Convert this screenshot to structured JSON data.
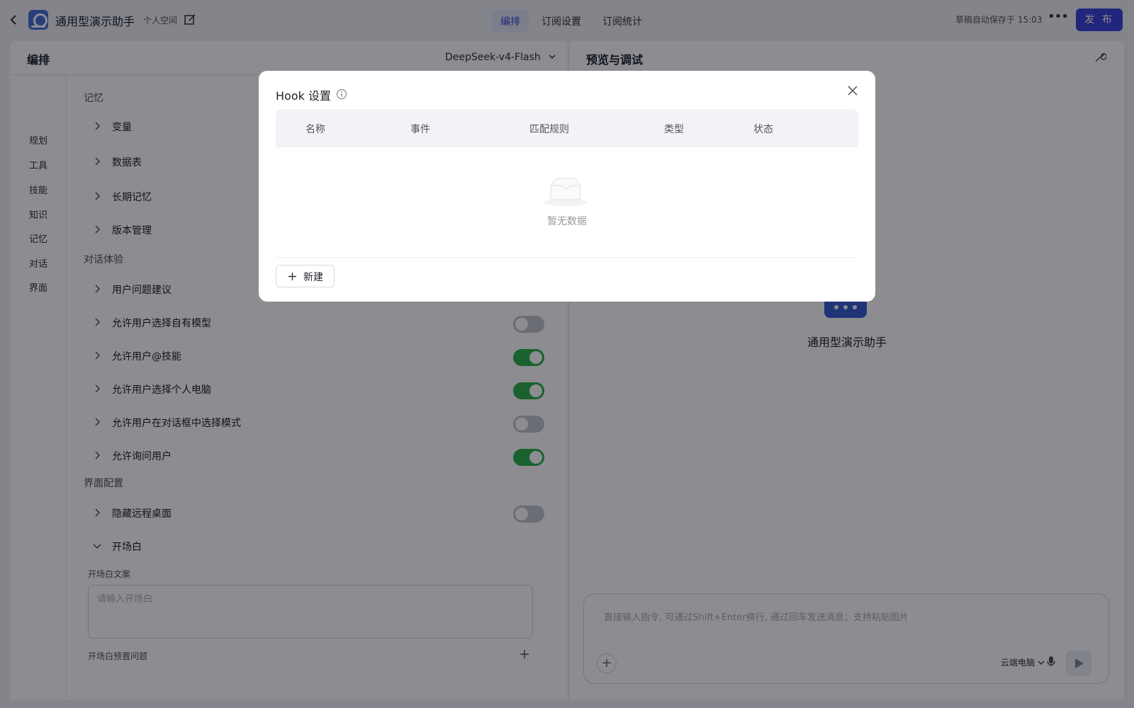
{
  "topbar": {
    "app_title": "通用型演示助手",
    "space_label": "个人空间",
    "tabs": [
      {
        "label": "编排",
        "active": true
      },
      {
        "label": "订阅设置",
        "active": false
      },
      {
        "label": "订阅统计",
        "active": false
      }
    ],
    "autosave_text": "草稿自动保存于 15:03",
    "publish_label": "发 布",
    "publish_color": "#3c44d8"
  },
  "editor": {
    "title": "编排",
    "model": "DeepSeek-v4-Flash",
    "nav": [
      "规划",
      "工具",
      "技能",
      "知识",
      "记忆",
      "对话",
      "界面"
    ],
    "sections": {
      "memory": "记忆",
      "experience": "对话体验",
      "ui_config": "界面配置"
    },
    "rows": {
      "variables": "变量",
      "datatable": "数据表",
      "longterm_memory": "长期记忆",
      "version_mgmt": "版本管理",
      "question_suggest": "用户问题建议",
      "allow_model": "允许用户选择自有模型",
      "allow_skill": "允许用户@技能",
      "allow_pc": "允许用户选择个人电脑",
      "allow_mode": "允许用户在对话框中选择模式",
      "allow_ask": "允许询问用户",
      "hide_desktop": "隐藏远程桌面",
      "opening": "开场白"
    },
    "toggles": {
      "allow_model": false,
      "allow_skill": true,
      "allow_pc": true,
      "allow_mode": false,
      "allow_ask": true,
      "hide_desktop": false
    },
    "opening_text_label": "开场白文案",
    "opening_placeholder": "请输入开场白",
    "opening_questions_label": "开场白预置问题"
  },
  "preview": {
    "title": "预览与调试",
    "bot_name": "通用型演示助手",
    "chat_placeholder": "直接输入指令, 可通过Shift+Enter换行, 通过回车发送消息；支持粘贴图片",
    "cloud_pc_label": "云端电脑"
  },
  "modal": {
    "title": "Hook 设置",
    "columns": [
      "名称",
      "事件",
      "匹配规则",
      "类型",
      "状态"
    ],
    "empty_text": "暂无数据",
    "new_button_label": "新建"
  },
  "colors": {
    "accent": "#3c44d8",
    "toggle_on": "#2fb34a",
    "toggle_off": "#c4c7cc"
  }
}
